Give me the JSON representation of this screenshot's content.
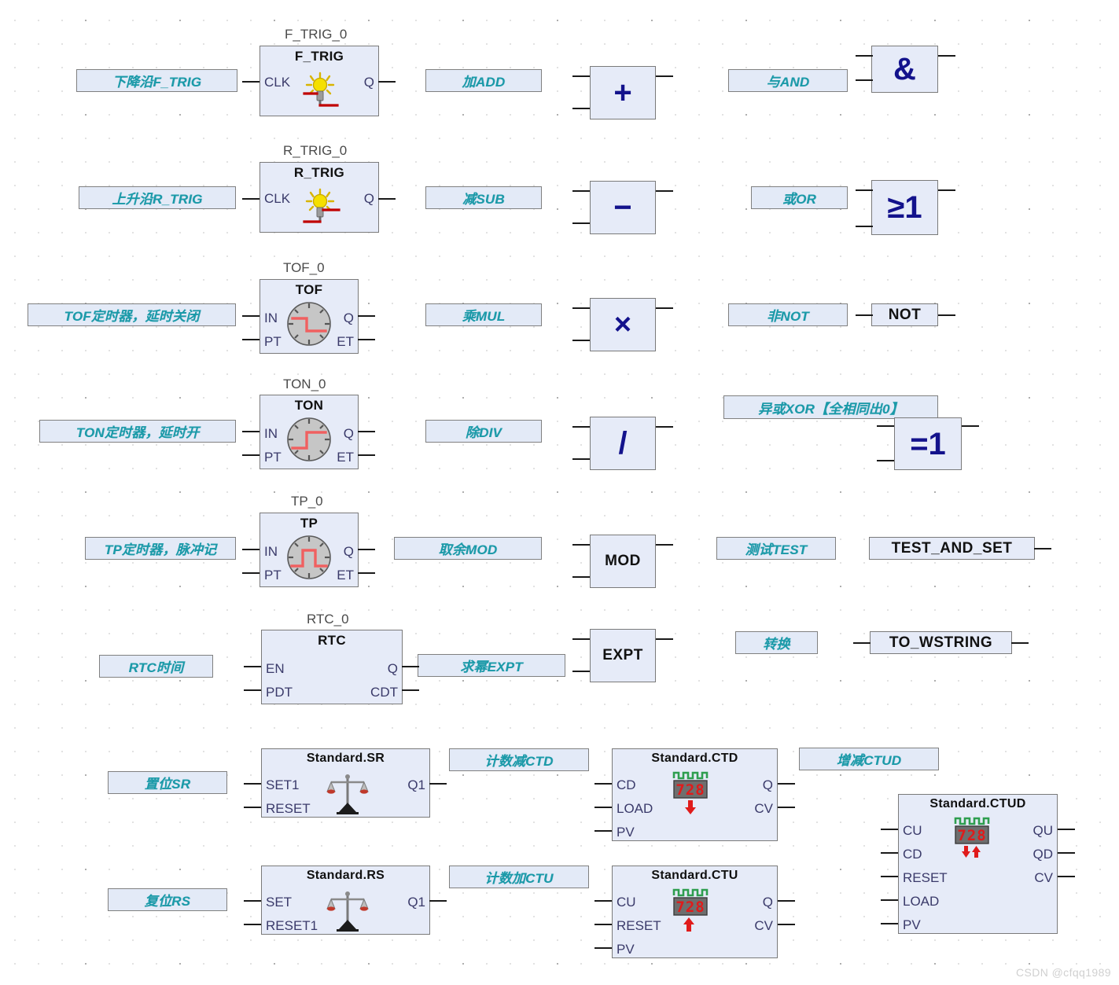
{
  "canvas": {
    "watermark": "CSDN @cfqq1989",
    "grid_dot_color": "#cfcfcf",
    "block_fill": "#e6ebf8",
    "block_border": "#7a7a7a",
    "comment_fill": "#e3eaf7",
    "comment_text_color": "#1a9aa8",
    "operator_glyph_color": "#13128c"
  },
  "rows": {
    "f_trig": {
      "comment": "下降沿F_TRIG",
      "instance": "F_TRIG_0",
      "title": "F_TRIG",
      "inputs": [
        "CLK"
      ],
      "outputs": [
        "Q"
      ],
      "icon": "falling-edge-lamp-icon"
    },
    "r_trig": {
      "comment": "上升沿R_TRIG",
      "instance": "R_TRIG_0",
      "title": "R_TRIG",
      "inputs": [
        "CLK"
      ],
      "outputs": [
        "Q"
      ],
      "icon": "rising-edge-lamp-icon"
    },
    "tof": {
      "comment": "TOF定时器，延时关闭",
      "instance": "TOF_0",
      "title": "TOF",
      "inputs": [
        "IN",
        "PT"
      ],
      "outputs": [
        "Q",
        "ET"
      ],
      "icon": "clock-falling-icon"
    },
    "ton": {
      "comment": "TON定时器，延时开",
      "instance": "TON_0",
      "title": "TON",
      "inputs": [
        "IN",
        "PT"
      ],
      "outputs": [
        "Q",
        "ET"
      ],
      "icon": "clock-rising-icon"
    },
    "tp": {
      "comment": "TP定时器，脉冲记",
      "instance": "TP_0",
      "title": "TP",
      "inputs": [
        "IN",
        "PT"
      ],
      "outputs": [
        "Q",
        "ET"
      ],
      "icon": "clock-pulse-icon"
    },
    "rtc": {
      "comment": "RTC时间",
      "instance": "RTC_0",
      "title": "RTC",
      "inputs": [
        "EN",
        "PDT"
      ],
      "outputs": [
        "Q",
        "CDT"
      ],
      "icon": "none"
    },
    "sr": {
      "comment": "置位SR",
      "title": "Standard.SR",
      "inputs": [
        "SET1",
        "RESET"
      ],
      "outputs": [
        "Q1"
      ],
      "icon": "balance-scale-icon"
    },
    "rs": {
      "comment": "复位RS",
      "title": "Standard.RS",
      "inputs": [
        "SET",
        "RESET1"
      ],
      "outputs": [
        "Q1"
      ],
      "icon": "balance-scale-icon"
    }
  },
  "math": {
    "add": {
      "comment": "加ADD",
      "glyph": "+",
      "inputs": 2,
      "outputs": 1
    },
    "sub": {
      "comment": "减SUB",
      "glyph": "−",
      "inputs": 2,
      "outputs": 1
    },
    "mul": {
      "comment": "乘MUL",
      "glyph": "×",
      "inputs": 2,
      "outputs": 1
    },
    "div": {
      "comment": "除DIV",
      "glyph": "/",
      "inputs": 2,
      "outputs": 1
    },
    "mod": {
      "comment": "取余MOD",
      "glyph": "MOD",
      "inputs": 2,
      "outputs": 1
    },
    "expt": {
      "comment": "求幂EXPT",
      "glyph": "EXPT",
      "inputs": 2,
      "outputs": 1
    }
  },
  "logic": {
    "and": {
      "comment": "与AND",
      "glyph": "&",
      "inputs": 2,
      "outputs": 1
    },
    "or": {
      "comment": "或OR",
      "glyph": "≥1",
      "inputs": 2,
      "outputs": 1
    },
    "not": {
      "comment": "非NOT",
      "glyph": "NOT",
      "inputs": 1,
      "outputs": 1
    },
    "xor": {
      "comment": "异或XOR【全相同出0】",
      "glyph": "=1",
      "inputs": 2,
      "outputs": 1
    },
    "test": {
      "comment": "测试TEST",
      "glyph": "TEST_AND_SET",
      "inputs": 0,
      "outputs": 1
    },
    "convert": {
      "comment": "转换",
      "glyph": "TO_WSTRING",
      "inputs": 1,
      "outputs": 1
    }
  },
  "counters": {
    "ctd": {
      "comment": "计数减CTD",
      "title": "Standard.CTD",
      "inputs": [
        "CD",
        "LOAD",
        "PV"
      ],
      "outputs": [
        "Q",
        "CV"
      ],
      "icon": "counter-down-icon",
      "display_digits": "728"
    },
    "ctu": {
      "comment": "计数加CTU",
      "title": "Standard.CTU",
      "inputs": [
        "CU",
        "RESET",
        "PV"
      ],
      "outputs": [
        "Q",
        "CV"
      ],
      "icon": "counter-up-icon",
      "display_digits": "728"
    },
    "ctud": {
      "comment": "增减CTUD",
      "title": "Standard.CTUD",
      "inputs": [
        "CU",
        "CD",
        "RESET",
        "LOAD",
        "PV"
      ],
      "outputs": [
        "QU",
        "QD",
        "CV"
      ],
      "icon": "counter-updown-icon",
      "display_digits": "728"
    }
  }
}
